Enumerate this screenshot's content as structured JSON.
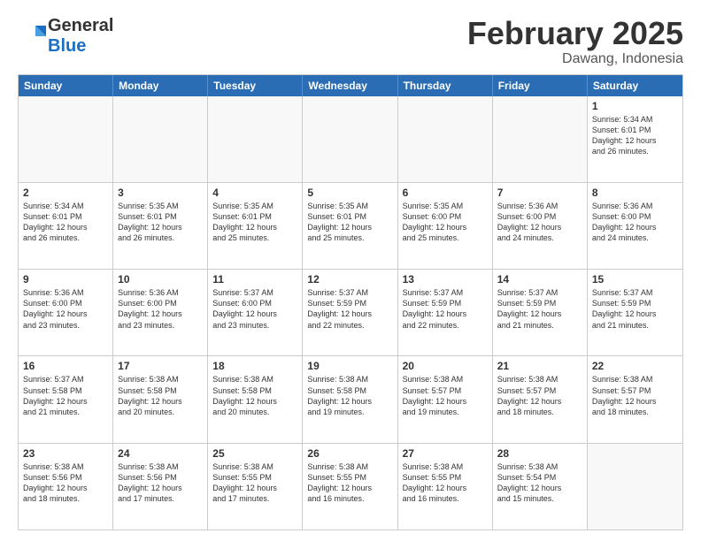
{
  "header": {
    "logo_general": "General",
    "logo_blue": "Blue",
    "month_title": "February 2025",
    "location": "Dawang, Indonesia"
  },
  "days_of_week": [
    "Sunday",
    "Monday",
    "Tuesday",
    "Wednesday",
    "Thursday",
    "Friday",
    "Saturday"
  ],
  "weeks": [
    [
      {
        "day": "",
        "info": "",
        "empty": true
      },
      {
        "day": "",
        "info": "",
        "empty": true
      },
      {
        "day": "",
        "info": "",
        "empty": true
      },
      {
        "day": "",
        "info": "",
        "empty": true
      },
      {
        "day": "",
        "info": "",
        "empty": true
      },
      {
        "day": "",
        "info": "",
        "empty": true
      },
      {
        "day": "1",
        "info": "Sunrise: 5:34 AM\nSunset: 6:01 PM\nDaylight: 12 hours\nand 26 minutes.",
        "empty": false
      }
    ],
    [
      {
        "day": "2",
        "info": "Sunrise: 5:34 AM\nSunset: 6:01 PM\nDaylight: 12 hours\nand 26 minutes.",
        "empty": false
      },
      {
        "day": "3",
        "info": "Sunrise: 5:35 AM\nSunset: 6:01 PM\nDaylight: 12 hours\nand 26 minutes.",
        "empty": false
      },
      {
        "day": "4",
        "info": "Sunrise: 5:35 AM\nSunset: 6:01 PM\nDaylight: 12 hours\nand 25 minutes.",
        "empty": false
      },
      {
        "day": "5",
        "info": "Sunrise: 5:35 AM\nSunset: 6:01 PM\nDaylight: 12 hours\nand 25 minutes.",
        "empty": false
      },
      {
        "day": "6",
        "info": "Sunrise: 5:35 AM\nSunset: 6:00 PM\nDaylight: 12 hours\nand 25 minutes.",
        "empty": false
      },
      {
        "day": "7",
        "info": "Sunrise: 5:36 AM\nSunset: 6:00 PM\nDaylight: 12 hours\nand 24 minutes.",
        "empty": false
      },
      {
        "day": "8",
        "info": "Sunrise: 5:36 AM\nSunset: 6:00 PM\nDaylight: 12 hours\nand 24 minutes.",
        "empty": false
      }
    ],
    [
      {
        "day": "9",
        "info": "Sunrise: 5:36 AM\nSunset: 6:00 PM\nDaylight: 12 hours\nand 23 minutes.",
        "empty": false
      },
      {
        "day": "10",
        "info": "Sunrise: 5:36 AM\nSunset: 6:00 PM\nDaylight: 12 hours\nand 23 minutes.",
        "empty": false
      },
      {
        "day": "11",
        "info": "Sunrise: 5:37 AM\nSunset: 6:00 PM\nDaylight: 12 hours\nand 23 minutes.",
        "empty": false
      },
      {
        "day": "12",
        "info": "Sunrise: 5:37 AM\nSunset: 5:59 PM\nDaylight: 12 hours\nand 22 minutes.",
        "empty": false
      },
      {
        "day": "13",
        "info": "Sunrise: 5:37 AM\nSunset: 5:59 PM\nDaylight: 12 hours\nand 22 minutes.",
        "empty": false
      },
      {
        "day": "14",
        "info": "Sunrise: 5:37 AM\nSunset: 5:59 PM\nDaylight: 12 hours\nand 21 minutes.",
        "empty": false
      },
      {
        "day": "15",
        "info": "Sunrise: 5:37 AM\nSunset: 5:59 PM\nDaylight: 12 hours\nand 21 minutes.",
        "empty": false
      }
    ],
    [
      {
        "day": "16",
        "info": "Sunrise: 5:37 AM\nSunset: 5:58 PM\nDaylight: 12 hours\nand 21 minutes.",
        "empty": false
      },
      {
        "day": "17",
        "info": "Sunrise: 5:38 AM\nSunset: 5:58 PM\nDaylight: 12 hours\nand 20 minutes.",
        "empty": false
      },
      {
        "day": "18",
        "info": "Sunrise: 5:38 AM\nSunset: 5:58 PM\nDaylight: 12 hours\nand 20 minutes.",
        "empty": false
      },
      {
        "day": "19",
        "info": "Sunrise: 5:38 AM\nSunset: 5:58 PM\nDaylight: 12 hours\nand 19 minutes.",
        "empty": false
      },
      {
        "day": "20",
        "info": "Sunrise: 5:38 AM\nSunset: 5:57 PM\nDaylight: 12 hours\nand 19 minutes.",
        "empty": false
      },
      {
        "day": "21",
        "info": "Sunrise: 5:38 AM\nSunset: 5:57 PM\nDaylight: 12 hours\nand 18 minutes.",
        "empty": false
      },
      {
        "day": "22",
        "info": "Sunrise: 5:38 AM\nSunset: 5:57 PM\nDaylight: 12 hours\nand 18 minutes.",
        "empty": false
      }
    ],
    [
      {
        "day": "23",
        "info": "Sunrise: 5:38 AM\nSunset: 5:56 PM\nDaylight: 12 hours\nand 18 minutes.",
        "empty": false
      },
      {
        "day": "24",
        "info": "Sunrise: 5:38 AM\nSunset: 5:56 PM\nDaylight: 12 hours\nand 17 minutes.",
        "empty": false
      },
      {
        "day": "25",
        "info": "Sunrise: 5:38 AM\nSunset: 5:55 PM\nDaylight: 12 hours\nand 17 minutes.",
        "empty": false
      },
      {
        "day": "26",
        "info": "Sunrise: 5:38 AM\nSunset: 5:55 PM\nDaylight: 12 hours\nand 16 minutes.",
        "empty": false
      },
      {
        "day": "27",
        "info": "Sunrise: 5:38 AM\nSunset: 5:55 PM\nDaylight: 12 hours\nand 16 minutes.",
        "empty": false
      },
      {
        "day": "28",
        "info": "Sunrise: 5:38 AM\nSunset: 5:54 PM\nDaylight: 12 hours\nand 15 minutes.",
        "empty": false
      },
      {
        "day": "",
        "info": "",
        "empty": true
      }
    ]
  ]
}
